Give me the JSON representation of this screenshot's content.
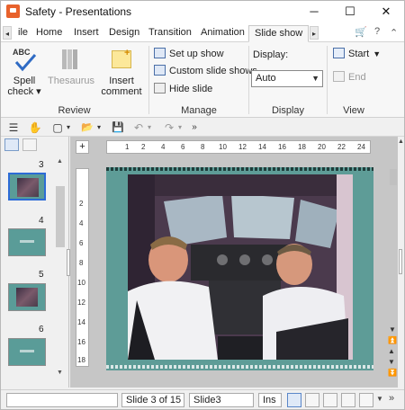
{
  "window": {
    "title": "Safety - Presentations",
    "minimize_glyph": "─",
    "maximize_glyph": "☐",
    "close_glyph": "✕"
  },
  "tabs": {
    "scroll_left": "◂",
    "scroll_right": "▸",
    "items": [
      "ile",
      "Home",
      "Insert",
      "Design",
      "Transition",
      "Animation",
      "Slide show"
    ],
    "active_index": 6,
    "cart_glyph": "🛒",
    "help_glyph": "?",
    "collapse_glyph": "⌃"
  },
  "ribbon": {
    "review": {
      "label": "Review",
      "spell_check": "Spell check ▾",
      "spell_icon_text": "ABC",
      "thesaurus": "Thesaurus",
      "insert_comment": "Insert comment"
    },
    "manage": {
      "label": "Manage",
      "setup_show": "Set up show",
      "custom_shows": "Custom slide shows",
      "hide_slide": "Hide slide"
    },
    "display": {
      "label": "Display",
      "field_label": "Display:",
      "value": "Auto"
    },
    "view": {
      "label": "View",
      "start": "Start",
      "end": "End"
    }
  },
  "toolbar": {
    "menu_glyph": "☰",
    "hand_glyph": "✋",
    "new_glyph": "▢",
    "open_glyph": "📂",
    "save_glyph": "💾",
    "undo_glyph": "↶",
    "redo_glyph": "↷",
    "more_glyph": "»",
    "dropdown_glyph": "▾"
  },
  "slides_panel": {
    "thumbnails": [
      {
        "number": "3",
        "selected": true
      },
      {
        "number": "4",
        "selected": false
      },
      {
        "number": "5",
        "selected": false
      },
      {
        "number": "6",
        "selected": false
      }
    ]
  },
  "ruler": {
    "h_ticks": [
      "1",
      "2",
      "4",
      "6",
      "8",
      "10",
      "12",
      "14",
      "16",
      "18",
      "20",
      "22",
      "24"
    ],
    "v_ticks": [
      "2",
      "4",
      "6",
      "8",
      "10",
      "12",
      "14",
      "16",
      "18"
    ]
  },
  "statusbar": {
    "slide_info": "Slide 3 of 15",
    "slide_name": "Slide3",
    "mode": "Ins"
  }
}
